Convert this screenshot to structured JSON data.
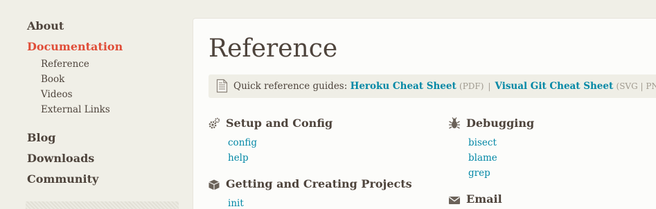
{
  "sidebar": {
    "about": "About",
    "documentation": "Documentation",
    "sub_items": [
      "Reference",
      "Book",
      "Videos",
      "External Links"
    ],
    "blog": "Blog",
    "downloads": "Downloads",
    "community": "Community"
  },
  "main": {
    "title": "Reference",
    "quickref": {
      "label": "Quick reference guides:",
      "heroku_link": "Heroku Cheat Sheet",
      "heroku_format": "(PDF)",
      "separator": "|",
      "visual_link": "Visual Git Cheat Sheet",
      "visual_format": "(SVG | PNG)"
    },
    "sections": {
      "setup": {
        "title": "Setup and Config",
        "icon": "gears-icon",
        "commands": [
          "config",
          "help"
        ]
      },
      "projects": {
        "title": "Getting and Creating Projects",
        "icon": "box-icon",
        "commands": [
          "init"
        ]
      },
      "debugging": {
        "title": "Debugging",
        "icon": "bug-icon",
        "commands": [
          "bisect",
          "blame",
          "grep"
        ]
      },
      "email": {
        "title": "Email",
        "icon": "envelope-icon",
        "commands": []
      }
    }
  },
  "colors": {
    "accent": "#e04e39",
    "link": "#0388a6",
    "text": "#4e443c",
    "background": "#f0efe7"
  }
}
